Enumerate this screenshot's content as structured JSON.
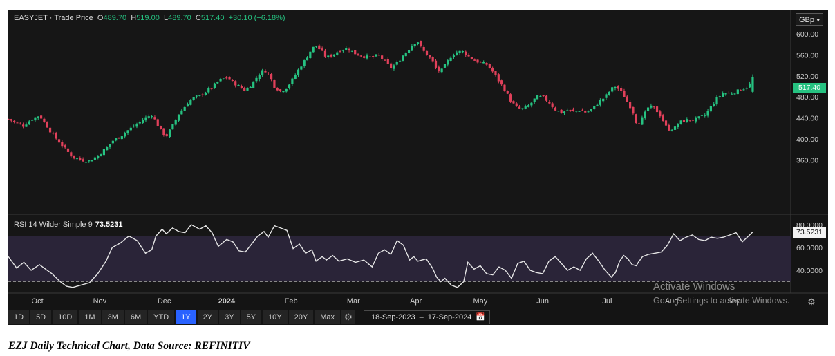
{
  "header": {
    "symbol": "EASYJET",
    "sep": "·",
    "desc": "Trade Price",
    "o_label": "O",
    "o_value": "489.70",
    "h_label": "H",
    "h_value": "519.00",
    "l_label": "L",
    "l_value": "489.70",
    "c_label": "C",
    "c_value": "517.40",
    "change": "+30.10 (+6.18%)"
  },
  "currency": "GBp",
  "last_price_tag": "517.40",
  "rsi": {
    "label": "RSI 14 Wilder Simple 9",
    "value": "73.5231",
    "axis_ticks": [
      "80.0000",
      "60.0000",
      "40.0000"
    ],
    "levels": [
      70,
      30
    ]
  },
  "toolbar": {
    "ranges": [
      "1D",
      "5D",
      "10D",
      "1M",
      "3M",
      "6M",
      "YTD",
      "1Y",
      "2Y",
      "3Y",
      "5Y",
      "10Y",
      "20Y",
      "Max"
    ],
    "active": "1Y",
    "date_from": "18-Sep-2023",
    "date_sep": "–",
    "date_to": "17-Sep-2024"
  },
  "watermark": {
    "line1": "Activate Windows",
    "line2": "Go to Settings to activate Windows."
  },
  "caption": "EZJ Daily Technical Chart, Data Source: REFINITIV",
  "colors": {
    "up": "#26c281",
    "down": "#e0405a",
    "rsi_line": "#e6e6e6",
    "rsi_band": "#2a2438",
    "active_range": "#2962ff"
  },
  "chart_data": [
    {
      "type": "candlestick",
      "x_labels": [
        "Oct",
        "Nov",
        "Dec",
        "2024",
        "Feb",
        "Mar",
        "Apr",
        "May",
        "Jun",
        "Jul",
        "Aug",
        "Sep"
      ],
      "y_ticks": [
        "600.00",
        "560.00",
        "520.00",
        "480.00",
        "440.00",
        "400.00",
        "360.00"
      ],
      "ylim": [
        325,
        635
      ],
      "close_path": [
        [
          0,
          438
        ],
        [
          8,
          430
        ],
        [
          15,
          426
        ],
        [
          22,
          437
        ],
        [
          30,
          445
        ],
        [
          36,
          428
        ],
        [
          42,
          410
        ],
        [
          50,
          392
        ],
        [
          56,
          378
        ],
        [
          62,
          365
        ],
        [
          70,
          360
        ],
        [
          78,
          358
        ],
        [
          86,
          368
        ],
        [
          94,
          382
        ],
        [
          100,
          396
        ],
        [
          108,
          405
        ],
        [
          116,
          418
        ],
        [
          124,
          428
        ],
        [
          132,
          440
        ],
        [
          138,
          446
        ],
        [
          142,
          433
        ],
        [
          148,
          412
        ],
        [
          152,
          405
        ],
        [
          158,
          425
        ],
        [
          164,
          448
        ],
        [
          170,
          462
        ],
        [
          176,
          476
        ],
        [
          184,
          482
        ],
        [
          190,
          490
        ],
        [
          196,
          498
        ],
        [
          202,
          510
        ],
        [
          210,
          517
        ],
        [
          216,
          508
        ],
        [
          222,
          500
        ],
        [
          228,
          492
        ],
        [
          234,
          504
        ],
        [
          240,
          520
        ],
        [
          246,
          532
        ],
        [
          250,
          525
        ],
        [
          256,
          500
        ],
        [
          262,
          490
        ],
        [
          268,
          498
        ],
        [
          274,
          515
        ],
        [
          280,
          535
        ],
        [
          286,
          552
        ],
        [
          292,
          572
        ],
        [
          296,
          578
        ],
        [
          302,
          565
        ],
        [
          306,
          555
        ],
        [
          312,
          560
        ],
        [
          318,
          568
        ],
        [
          326,
          573
        ],
        [
          334,
          562
        ],
        [
          342,
          557
        ],
        [
          350,
          555
        ],
        [
          356,
          560
        ],
        [
          362,
          548
        ],
        [
          368,
          535
        ],
        [
          374,
          545
        ],
        [
          380,
          560
        ],
        [
          386,
          573
        ],
        [
          390,
          583
        ],
        [
          394,
          585
        ],
        [
          398,
          570
        ],
        [
          402,
          562
        ],
        [
          408,
          548
        ],
        [
          412,
          532
        ],
        [
          416,
          528
        ],
        [
          420,
          540
        ],
        [
          426,
          558
        ],
        [
          432,
          566
        ],
        [
          438,
          566
        ],
        [
          442,
          558
        ],
        [
          448,
          550
        ],
        [
          454,
          545
        ],
        [
          460,
          542
        ],
        [
          466,
          528
        ],
        [
          472,
          510
        ],
        [
          478,
          492
        ],
        [
          484,
          470
        ],
        [
          490,
          458
        ],
        [
          496,
          457
        ],
        [
          502,
          466
        ],
        [
          508,
          480
        ],
        [
          514,
          480
        ],
        [
          520,
          470
        ],
        [
          526,
          456
        ],
        [
          532,
          450
        ],
        [
          538,
          455
        ],
        [
          544,
          452
        ],
        [
          550,
          455
        ],
        [
          556,
          450
        ],
        [
          562,
          458
        ],
        [
          568,
          470
        ],
        [
          574,
          480
        ],
        [
          580,
          495
        ],
        [
          584,
          500
        ],
        [
          588,
          493
        ],
        [
          592,
          482
        ],
        [
          596,
          468
        ],
        [
          600,
          456
        ],
        [
          604,
          432
        ],
        [
          606,
          430
        ],
        [
          610,
          440
        ],
        [
          616,
          462
        ],
        [
          622,
          458
        ],
        [
          628,
          442
        ],
        [
          634,
          418
        ],
        [
          640,
          420
        ],
        [
          646,
          432
        ],
        [
          652,
          436
        ],
        [
          658,
          436
        ],
        [
          664,
          440
        ],
        [
          670,
          445
        ],
        [
          676,
          462
        ],
        [
          682,
          478
        ],
        [
          688,
          488
        ],
        [
          694,
          486
        ],
        [
          700,
          490
        ],
        [
          706,
          495
        ],
        [
          712,
          500
        ],
        [
          716,
          515
        ]
      ]
    },
    {
      "type": "line",
      "name": "RSI",
      "ylim": [
        28,
        85
      ],
      "values": [
        [
          0,
          52
        ],
        [
          8,
          42
        ],
        [
          15,
          47
        ],
        [
          22,
          40
        ],
        [
          30,
          45
        ],
        [
          36,
          41
        ],
        [
          42,
          37
        ],
        [
          50,
          30
        ],
        [
          56,
          26
        ],
        [
          62,
          25
        ],
        [
          70,
          27
        ],
        [
          78,
          29
        ],
        [
          86,
          37
        ],
        [
          94,
          48
        ],
        [
          100,
          60
        ],
        [
          108,
          64
        ],
        [
          116,
          70
        ],
        [
          124,
          66
        ],
        [
          132,
          55
        ],
        [
          138,
          58
        ],
        [
          142,
          70
        ],
        [
          148,
          76
        ],
        [
          152,
          72
        ],
        [
          158,
          77
        ],
        [
          164,
          74
        ],
        [
          170,
          73
        ],
        [
          176,
          80
        ],
        [
          184,
          76
        ],
        [
          190,
          79
        ],
        [
          196,
          73
        ],
        [
          202,
          61
        ],
        [
          210,
          67
        ],
        [
          216,
          65
        ],
        [
          222,
          57
        ],
        [
          228,
          56
        ],
        [
          234,
          63
        ],
        [
          240,
          70
        ],
        [
          246,
          74
        ],
        [
          250,
          69
        ],
        [
          256,
          79
        ],
        [
          262,
          77
        ],
        [
          268,
          75
        ],
        [
          274,
          59
        ],
        [
          280,
          63
        ],
        [
          286,
          55
        ],
        [
          292,
          58
        ],
        [
          296,
          48
        ],
        [
          302,
          52
        ],
        [
          306,
          49
        ],
        [
          312,
          53
        ],
        [
          318,
          48
        ],
        [
          326,
          50
        ],
        [
          334,
          47
        ],
        [
          342,
          49
        ],
        [
          350,
          43
        ],
        [
          356,
          55
        ],
        [
          362,
          58
        ],
        [
          368,
          54
        ],
        [
          374,
          66
        ],
        [
          380,
          62
        ],
        [
          386,
          49
        ],
        [
          390,
          52
        ],
        [
          394,
          48
        ],
        [
          398,
          49
        ],
        [
          402,
          50
        ],
        [
          408,
          42
        ],
        [
          412,
          34
        ],
        [
          416,
          30
        ],
        [
          420,
          33
        ],
        [
          426,
          27
        ],
        [
          432,
          25
        ],
        [
          438,
          30
        ],
        [
          442,
          47
        ],
        [
          448,
          41
        ],
        [
          454,
          44
        ],
        [
          460,
          37
        ],
        [
          466,
          36
        ],
        [
          472,
          43
        ],
        [
          478,
          40
        ],
        [
          484,
          33
        ],
        [
          490,
          46
        ],
        [
          496,
          48
        ],
        [
          502,
          40
        ],
        [
          508,
          38
        ],
        [
          514,
          37
        ],
        [
          520,
          48
        ],
        [
          526,
          52
        ],
        [
          532,
          46
        ],
        [
          538,
          40
        ],
        [
          544,
          43
        ],
        [
          550,
          40
        ],
        [
          556,
          50
        ],
        [
          562,
          55
        ],
        [
          568,
          48
        ],
        [
          574,
          40
        ],
        [
          580,
          34
        ],
        [
          584,
          38
        ],
        [
          588,
          48
        ],
        [
          592,
          53
        ],
        [
          596,
          50
        ],
        [
          600,
          45
        ],
        [
          604,
          44
        ],
        [
          606,
          47
        ],
        [
          610,
          52
        ],
        [
          616,
          54
        ],
        [
          622,
          55
        ],
        [
          628,
          56
        ],
        [
          634,
          62
        ],
        [
          640,
          72
        ],
        [
          646,
          66
        ],
        [
          652,
          69
        ],
        [
          658,
          71
        ],
        [
          664,
          67
        ],
        [
          670,
          66
        ],
        [
          676,
          69
        ],
        [
          682,
          68
        ],
        [
          688,
          69
        ],
        [
          694,
          71
        ],
        [
          700,
          73
        ],
        [
          706,
          65
        ],
        [
          712,
          70
        ],
        [
          716,
          73.5
        ]
      ]
    }
  ]
}
